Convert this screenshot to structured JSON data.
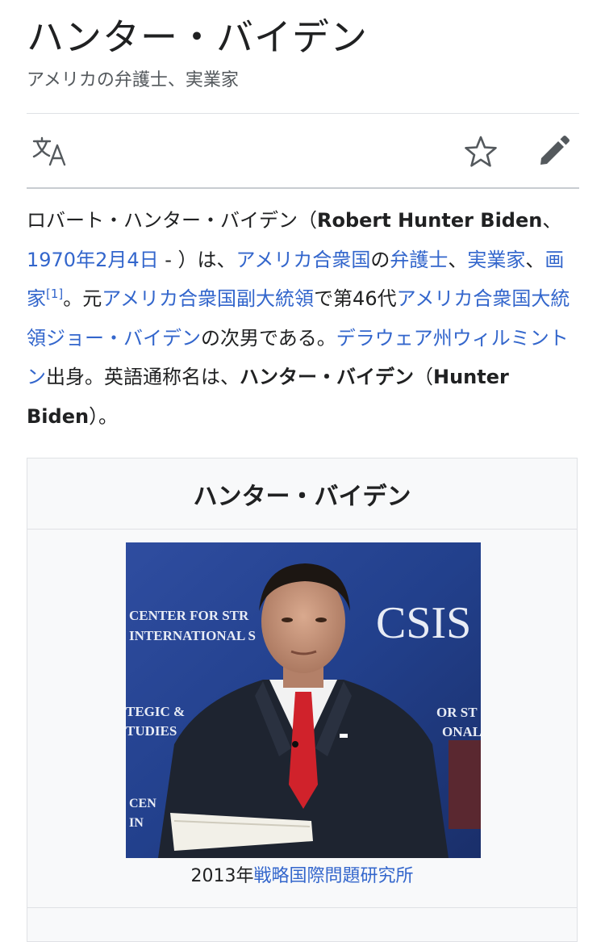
{
  "article": {
    "title": "ハンター・バイデン",
    "description": "アメリカの弁護士、実業家"
  },
  "toolbar": {
    "language_icon": "translate-icon",
    "watch_icon": "star-icon",
    "edit_icon": "pencil-icon"
  },
  "lead": {
    "t1": "ロバート・ハンター・バイデン（",
    "name_en": "Robert Hunter Biden",
    "t2": "、",
    "birth_date": "1970年2月4日",
    "t3": " - ）は、",
    "link_usa": "アメリカ合衆国",
    "t4": "の",
    "link_lawyer": "弁護士",
    "t5": "、",
    "link_businessman": "実業家",
    "t6": "、",
    "link_painter": "画家",
    "ref": "[1]",
    "t7": "。元",
    "link_vp": "アメリカ合衆国副大統領",
    "t8": "で第46代",
    "link_president": "アメリカ合衆国大統領ジョー・バイデン",
    "t9": "の次男である。",
    "link_wilmington": "デラウェア州ウィルミントン",
    "t10": "出身。英語通称名は、",
    "nickname_ja": "ハンター・バイデン",
    "t11": "（",
    "nickname_en": "Hunter Biden",
    "t12": "）。"
  },
  "infobox": {
    "title": "ハンター・バイデン",
    "image_sign_left_1": "CENTER FOR STR",
    "image_sign_left_2": "INTERNATIONAL S",
    "image_sign_mid_1": "TEGIC &",
    "image_sign_mid_2": "TUDIES",
    "image_sign_low_1": "CEN",
    "image_sign_low_2": "IN",
    "image_sign_right_1": "OR ST",
    "image_sign_right_2": "ONAL",
    "image_logo": "CSIS",
    "caption_prefix": "2013年",
    "caption_link": "戦略国際問題研究所"
  },
  "colors": {
    "link": "#3366cc",
    "text": "#202122",
    "muted": "#54595d",
    "infobox_bg": "#f8f9fa",
    "border": "#dfe1e5"
  }
}
